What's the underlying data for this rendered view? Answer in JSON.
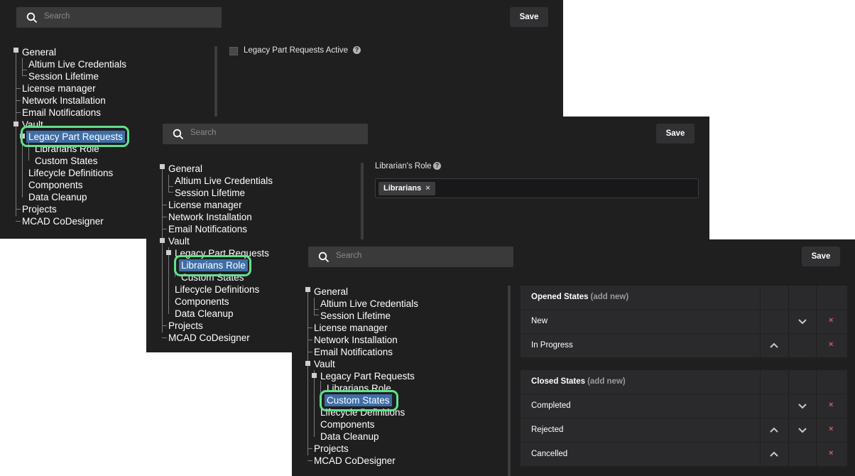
{
  "common": {
    "search_placeholder": "Search",
    "save_label": "Save"
  },
  "tree": [
    {
      "label": "General"
    },
    {
      "label": "Altium Live Credentials"
    },
    {
      "label": "Session Lifetime"
    },
    {
      "label": "License manager"
    },
    {
      "label": "Network Installation"
    },
    {
      "label": "Email Notifications"
    },
    {
      "label": "Vault"
    },
    {
      "label": "Legacy Part Requests"
    },
    {
      "label": "Librarians Role"
    },
    {
      "label": "Custom States"
    },
    {
      "label": "Lifecycle Definitions"
    },
    {
      "label": "Components"
    },
    {
      "label": "Data Cleanup"
    },
    {
      "label": "Projects"
    },
    {
      "label": "MCAD CoDesigner"
    }
  ],
  "panel1": {
    "selected_item": "Legacy Part Requests",
    "legacy_checkbox_label": "Legacy Part Requests Active",
    "legacy_checkbox_checked": false,
    "help_glyph": "?"
  },
  "panel2": {
    "selected_item": "Librarians Role",
    "role_label": "Librarian's Role",
    "help_glyph": "?",
    "chips": [
      {
        "label": "Librarians",
        "remove": "×"
      }
    ]
  },
  "panel3": {
    "selected_item": "Custom States",
    "opened": {
      "title": "Opened States",
      "add_new": "(add new)",
      "rows": [
        {
          "name": "New",
          "up": false,
          "down": true,
          "remove": "×"
        },
        {
          "name": "In Progress",
          "up": true,
          "down": false,
          "remove": "×"
        }
      ]
    },
    "closed": {
      "title": "Closed States",
      "add_new": "(add new)",
      "rows": [
        {
          "name": "Completed",
          "up": false,
          "down": true,
          "remove": "×"
        },
        {
          "name": "Rejected",
          "up": true,
          "down": true,
          "remove": "×"
        },
        {
          "name": "Cancelled",
          "up": true,
          "down": false,
          "remove": "×"
        }
      ]
    }
  },
  "colors": {
    "panel_bg": "#1f1f20",
    "selection": "#3f6ea6",
    "highlight_ring": "#62e18a",
    "remove_red": "#e05a5a"
  }
}
